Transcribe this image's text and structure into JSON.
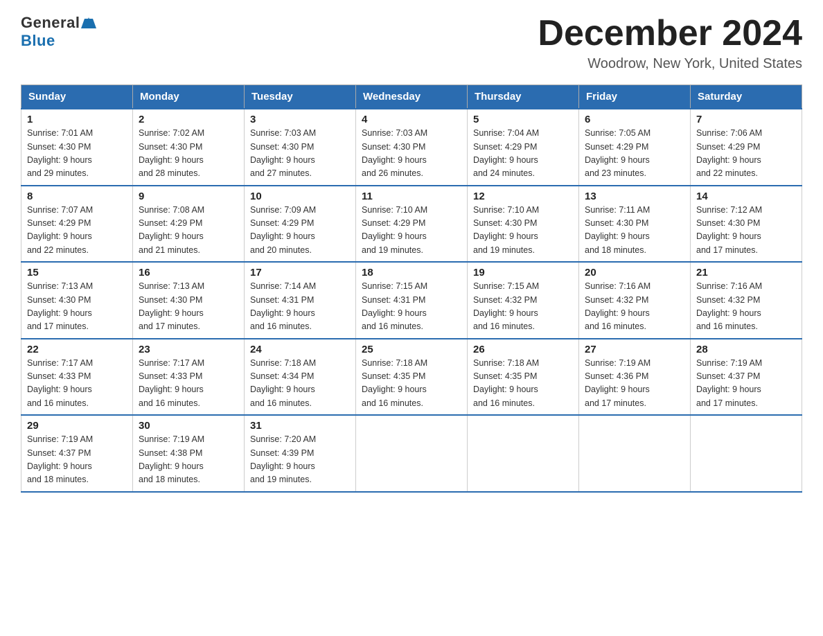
{
  "logo": {
    "general": "General",
    "blue": "Blue"
  },
  "header": {
    "month": "December 2024",
    "location": "Woodrow, New York, United States"
  },
  "days_of_week": [
    "Sunday",
    "Monday",
    "Tuesday",
    "Wednesday",
    "Thursday",
    "Friday",
    "Saturday"
  ],
  "weeks": [
    [
      {
        "day": "1",
        "sunrise": "7:01 AM",
        "sunset": "4:30 PM",
        "daylight": "9 hours and 29 minutes."
      },
      {
        "day": "2",
        "sunrise": "7:02 AM",
        "sunset": "4:30 PM",
        "daylight": "9 hours and 28 minutes."
      },
      {
        "day": "3",
        "sunrise": "7:03 AM",
        "sunset": "4:30 PM",
        "daylight": "9 hours and 27 minutes."
      },
      {
        "day": "4",
        "sunrise": "7:03 AM",
        "sunset": "4:30 PM",
        "daylight": "9 hours and 26 minutes."
      },
      {
        "day": "5",
        "sunrise": "7:04 AM",
        "sunset": "4:29 PM",
        "daylight": "9 hours and 24 minutes."
      },
      {
        "day": "6",
        "sunrise": "7:05 AM",
        "sunset": "4:29 PM",
        "daylight": "9 hours and 23 minutes."
      },
      {
        "day": "7",
        "sunrise": "7:06 AM",
        "sunset": "4:29 PM",
        "daylight": "9 hours and 22 minutes."
      }
    ],
    [
      {
        "day": "8",
        "sunrise": "7:07 AM",
        "sunset": "4:29 PM",
        "daylight": "9 hours and 22 minutes."
      },
      {
        "day": "9",
        "sunrise": "7:08 AM",
        "sunset": "4:29 PM",
        "daylight": "9 hours and 21 minutes."
      },
      {
        "day": "10",
        "sunrise": "7:09 AM",
        "sunset": "4:29 PM",
        "daylight": "9 hours and 20 minutes."
      },
      {
        "day": "11",
        "sunrise": "7:10 AM",
        "sunset": "4:29 PM",
        "daylight": "9 hours and 19 minutes."
      },
      {
        "day": "12",
        "sunrise": "7:10 AM",
        "sunset": "4:30 PM",
        "daylight": "9 hours and 19 minutes."
      },
      {
        "day": "13",
        "sunrise": "7:11 AM",
        "sunset": "4:30 PM",
        "daylight": "9 hours and 18 minutes."
      },
      {
        "day": "14",
        "sunrise": "7:12 AM",
        "sunset": "4:30 PM",
        "daylight": "9 hours and 17 minutes."
      }
    ],
    [
      {
        "day": "15",
        "sunrise": "7:13 AM",
        "sunset": "4:30 PM",
        "daylight": "9 hours and 17 minutes."
      },
      {
        "day": "16",
        "sunrise": "7:13 AM",
        "sunset": "4:30 PM",
        "daylight": "9 hours and 17 minutes."
      },
      {
        "day": "17",
        "sunrise": "7:14 AM",
        "sunset": "4:31 PM",
        "daylight": "9 hours and 16 minutes."
      },
      {
        "day": "18",
        "sunrise": "7:15 AM",
        "sunset": "4:31 PM",
        "daylight": "9 hours and 16 minutes."
      },
      {
        "day": "19",
        "sunrise": "7:15 AM",
        "sunset": "4:32 PM",
        "daylight": "9 hours and 16 minutes."
      },
      {
        "day": "20",
        "sunrise": "7:16 AM",
        "sunset": "4:32 PM",
        "daylight": "9 hours and 16 minutes."
      },
      {
        "day": "21",
        "sunrise": "7:16 AM",
        "sunset": "4:32 PM",
        "daylight": "9 hours and 16 minutes."
      }
    ],
    [
      {
        "day": "22",
        "sunrise": "7:17 AM",
        "sunset": "4:33 PM",
        "daylight": "9 hours and 16 minutes."
      },
      {
        "day": "23",
        "sunrise": "7:17 AM",
        "sunset": "4:33 PM",
        "daylight": "9 hours and 16 minutes."
      },
      {
        "day": "24",
        "sunrise": "7:18 AM",
        "sunset": "4:34 PM",
        "daylight": "9 hours and 16 minutes."
      },
      {
        "day": "25",
        "sunrise": "7:18 AM",
        "sunset": "4:35 PM",
        "daylight": "9 hours and 16 minutes."
      },
      {
        "day": "26",
        "sunrise": "7:18 AM",
        "sunset": "4:35 PM",
        "daylight": "9 hours and 16 minutes."
      },
      {
        "day": "27",
        "sunrise": "7:19 AM",
        "sunset": "4:36 PM",
        "daylight": "9 hours and 17 minutes."
      },
      {
        "day": "28",
        "sunrise": "7:19 AM",
        "sunset": "4:37 PM",
        "daylight": "9 hours and 17 minutes."
      }
    ],
    [
      {
        "day": "29",
        "sunrise": "7:19 AM",
        "sunset": "4:37 PM",
        "daylight": "9 hours and 18 minutes."
      },
      {
        "day": "30",
        "sunrise": "7:19 AM",
        "sunset": "4:38 PM",
        "daylight": "9 hours and 18 minutes."
      },
      {
        "day": "31",
        "sunrise": "7:20 AM",
        "sunset": "4:39 PM",
        "daylight": "9 hours and 19 minutes."
      },
      null,
      null,
      null,
      null
    ]
  ],
  "labels": {
    "sunrise": "Sunrise:",
    "sunset": "Sunset:",
    "daylight": "Daylight:"
  }
}
